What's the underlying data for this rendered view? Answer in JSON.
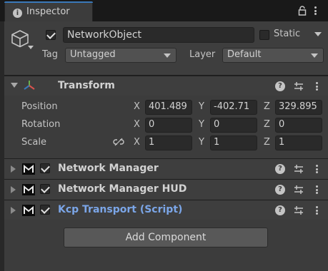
{
  "tab": {
    "title": "Inspector",
    "icon": "info-icon"
  },
  "header": {
    "object_name": "NetworkObject",
    "active": true,
    "static_label": "Static",
    "static_checked": false,
    "tag_label": "Tag",
    "tag_value": "Untagged",
    "layer_label": "Layer",
    "layer_value": "Default"
  },
  "transform": {
    "title": "Transform",
    "position": {
      "label": "Position",
      "x": "401.489",
      "y": "-402.71",
      "z": "329.895"
    },
    "rotation": {
      "label": "Rotation",
      "x": "0",
      "y": "0",
      "z": "0"
    },
    "scale": {
      "label": "Scale",
      "x": "1",
      "y": "1",
      "z": "1"
    },
    "axes": {
      "x": "X",
      "y": "Y",
      "z": "Z"
    }
  },
  "components": [
    {
      "title": "Network Manager",
      "enabled": true
    },
    {
      "title": "Network Manager HUD",
      "enabled": true
    },
    {
      "title": "Kcp Transport (Script)",
      "enabled": true
    }
  ],
  "add_component_label": "Add Component",
  "colors": {
    "accent": "#3a79bb",
    "link": "#7ba6e8",
    "panel": "#3c3c3c"
  }
}
